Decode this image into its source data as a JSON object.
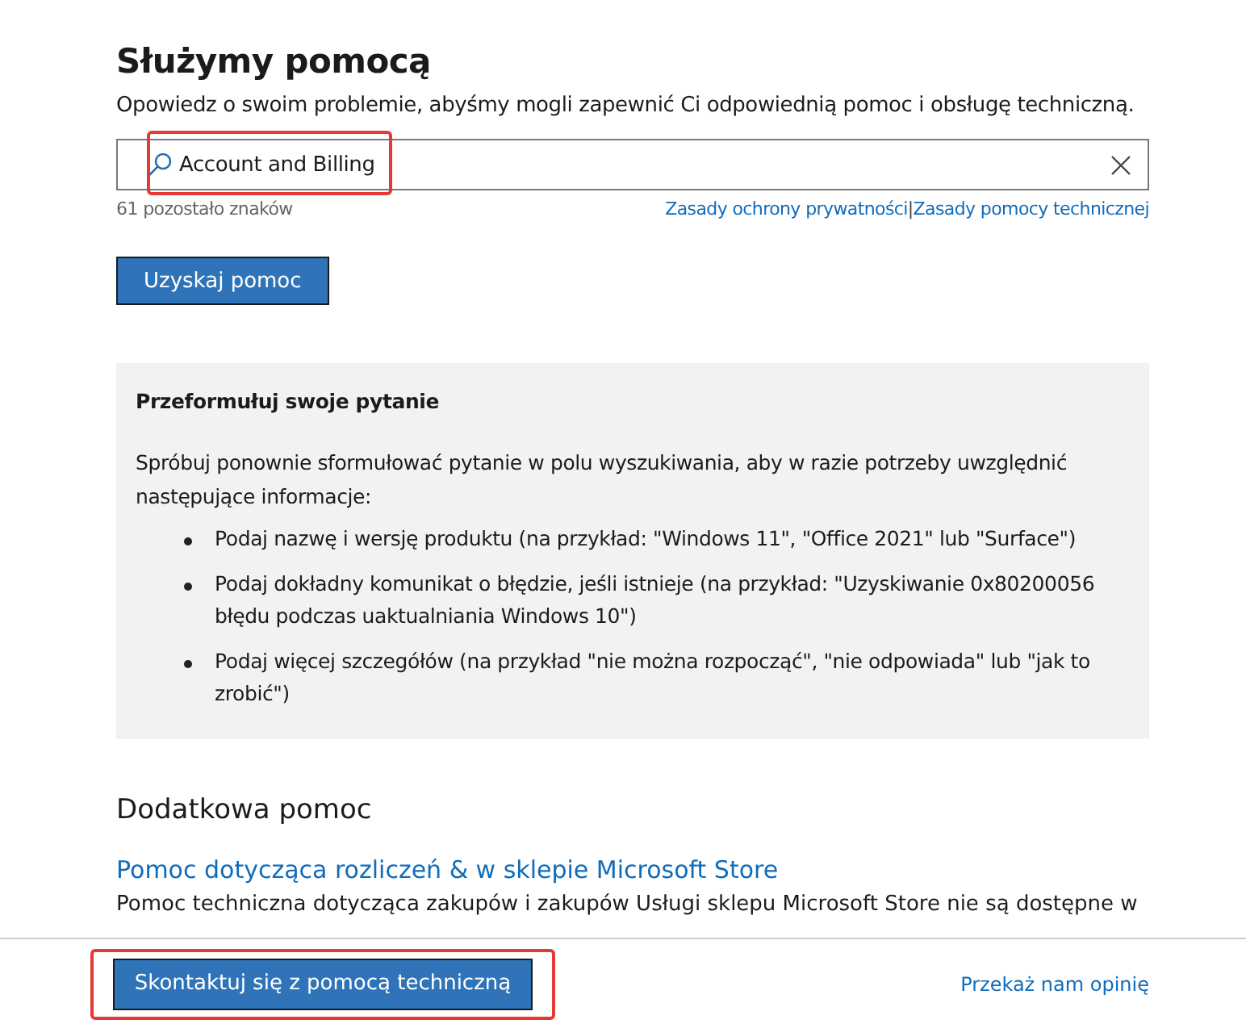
{
  "header": {
    "title": "Służymy pomocą",
    "subtitle": "Opowiedz o swoim problemie, abyśmy mogli zapewnić Ci odpowiednią pomoc i obsługę techniczną."
  },
  "search": {
    "value": "Account and Billing",
    "highlighted": true,
    "counter": "61 pozostało znaków",
    "links": [
      "Zasady ochrony prywatności",
      "Zasady pomocy technicznej"
    ],
    "separator": "|"
  },
  "get_help_button": "Uzyskaj pomoc",
  "notice": {
    "title": "Przeformułuj swoje pytanie",
    "text": "Spróbuj ponownie sformułować pytanie w polu wyszukiwania, aby w razie potrzeby uwzględnić następujące informacje:",
    "items": [
      "Podaj nazwę i wersję produktu (na przykład: \"Windows 11\", \"Office 2021\" lub \"Surface\")",
      "Podaj dokładny komunikat o błędzie, jeśli istnieje (na przykład: \"Uzyskiwanie 0x80200056 błędu podczas uaktualniania Windows 10\")",
      "Podaj więcej szczegółów (na przykład \"nie można rozpocząć\", \"nie odpowiada\" lub \"jak to zrobić\")"
    ]
  },
  "more_help": {
    "title": "Dodatkowa pomoc",
    "link": "Pomoc dotycząca rozliczeń & w sklepie Microsoft Store",
    "text": "Pomoc techniczna dotycząca zakupów i zakupów Usługi sklepu Microsoft Store nie są dostępne w"
  },
  "footer": {
    "contact_button": "Skontaktuj się z pomocą techniczną",
    "highlighted": true,
    "feedback_link": "Przekaż nam opinię"
  }
}
